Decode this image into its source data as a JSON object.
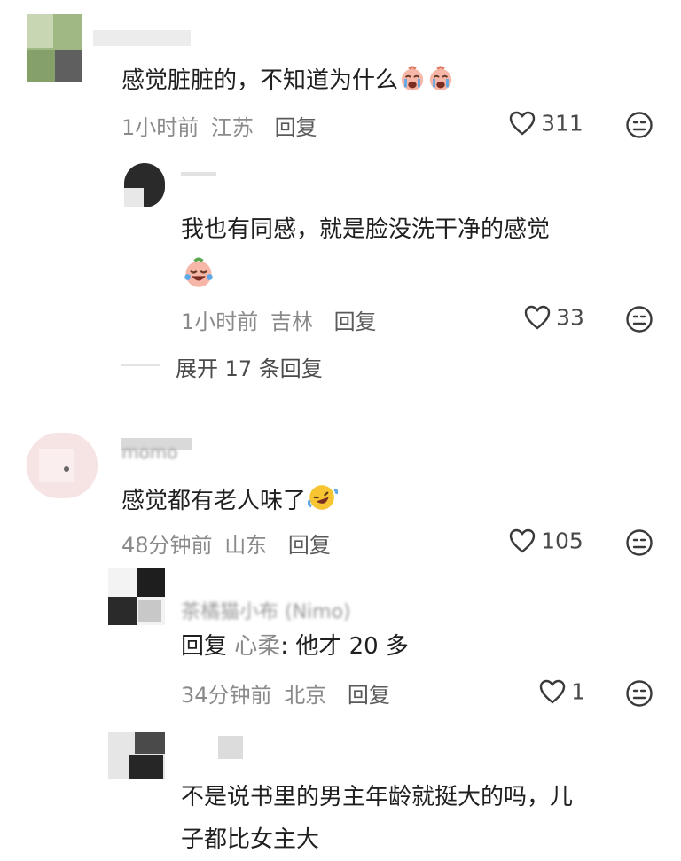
{
  "comments": [
    {
      "text": "感觉脏脏的，不知道为什么",
      "time": "1小时前",
      "location": "江苏",
      "reply_label": "回复",
      "likes": "311",
      "emoji": [
        "crying-face-icon",
        "crying-face-icon"
      ]
    },
    {
      "text_line1": "我也有同感，就是脸没洗干净的感觉",
      "time": "1小时前",
      "location": "吉林",
      "reply_label": "回复",
      "likes": "33",
      "emoji": [
        "laughing-tears-icon"
      ]
    },
    {
      "username": "momo",
      "text": "感觉都有老人味了",
      "time": "48分钟前",
      "location": "山东",
      "reply_label": "回复",
      "likes": "105",
      "emoji": [
        "rofl-face-icon"
      ]
    },
    {
      "username": "茶橘猫小布 (Nimo)",
      "reply_prefix": "回复",
      "mention": "心柔",
      "text": ": 他才 20 多",
      "time": "34分钟前",
      "location": "北京",
      "reply_label": "回复",
      "likes": "1"
    },
    {
      "text_line1": "不是说书里的男主年龄就挺大的吗，儿",
      "text_line2": "子都比女主大"
    }
  ],
  "expand_replies": "展开 17 条回复",
  "colors": {
    "text": "#1f1f1f",
    "meta": "#8a8a8a",
    "icon": "#3a3a3a",
    "background": "#ffffff"
  }
}
